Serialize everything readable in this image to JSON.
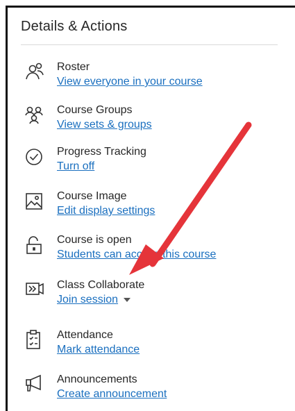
{
  "panel": {
    "title": "Details & Actions"
  },
  "items": [
    {
      "label": "Roster",
      "link": "View everyone in your course",
      "icon": "roster-icon"
    },
    {
      "label": "Course Groups",
      "link": "View sets & groups",
      "icon": "groups-icon"
    },
    {
      "label": "Progress Tracking",
      "link": "Turn off",
      "icon": "check-circle-icon"
    },
    {
      "label": "Course Image",
      "link": "Edit display settings",
      "icon": "image-icon"
    },
    {
      "label": "Course is open",
      "link": "Students can access this course",
      "icon": "unlock-icon"
    },
    {
      "label": "Class Collaborate",
      "link": "Join session",
      "icon": "collaborate-icon"
    },
    {
      "label": "Attendance",
      "link": "Mark attendance",
      "icon": "attendance-icon"
    },
    {
      "label": "Announcements",
      "link": "Create announcement",
      "icon": "megaphone-icon"
    }
  ],
  "colors": {
    "link": "#1a6fbf",
    "arrow": "#e5343a",
    "text": "#262626"
  }
}
